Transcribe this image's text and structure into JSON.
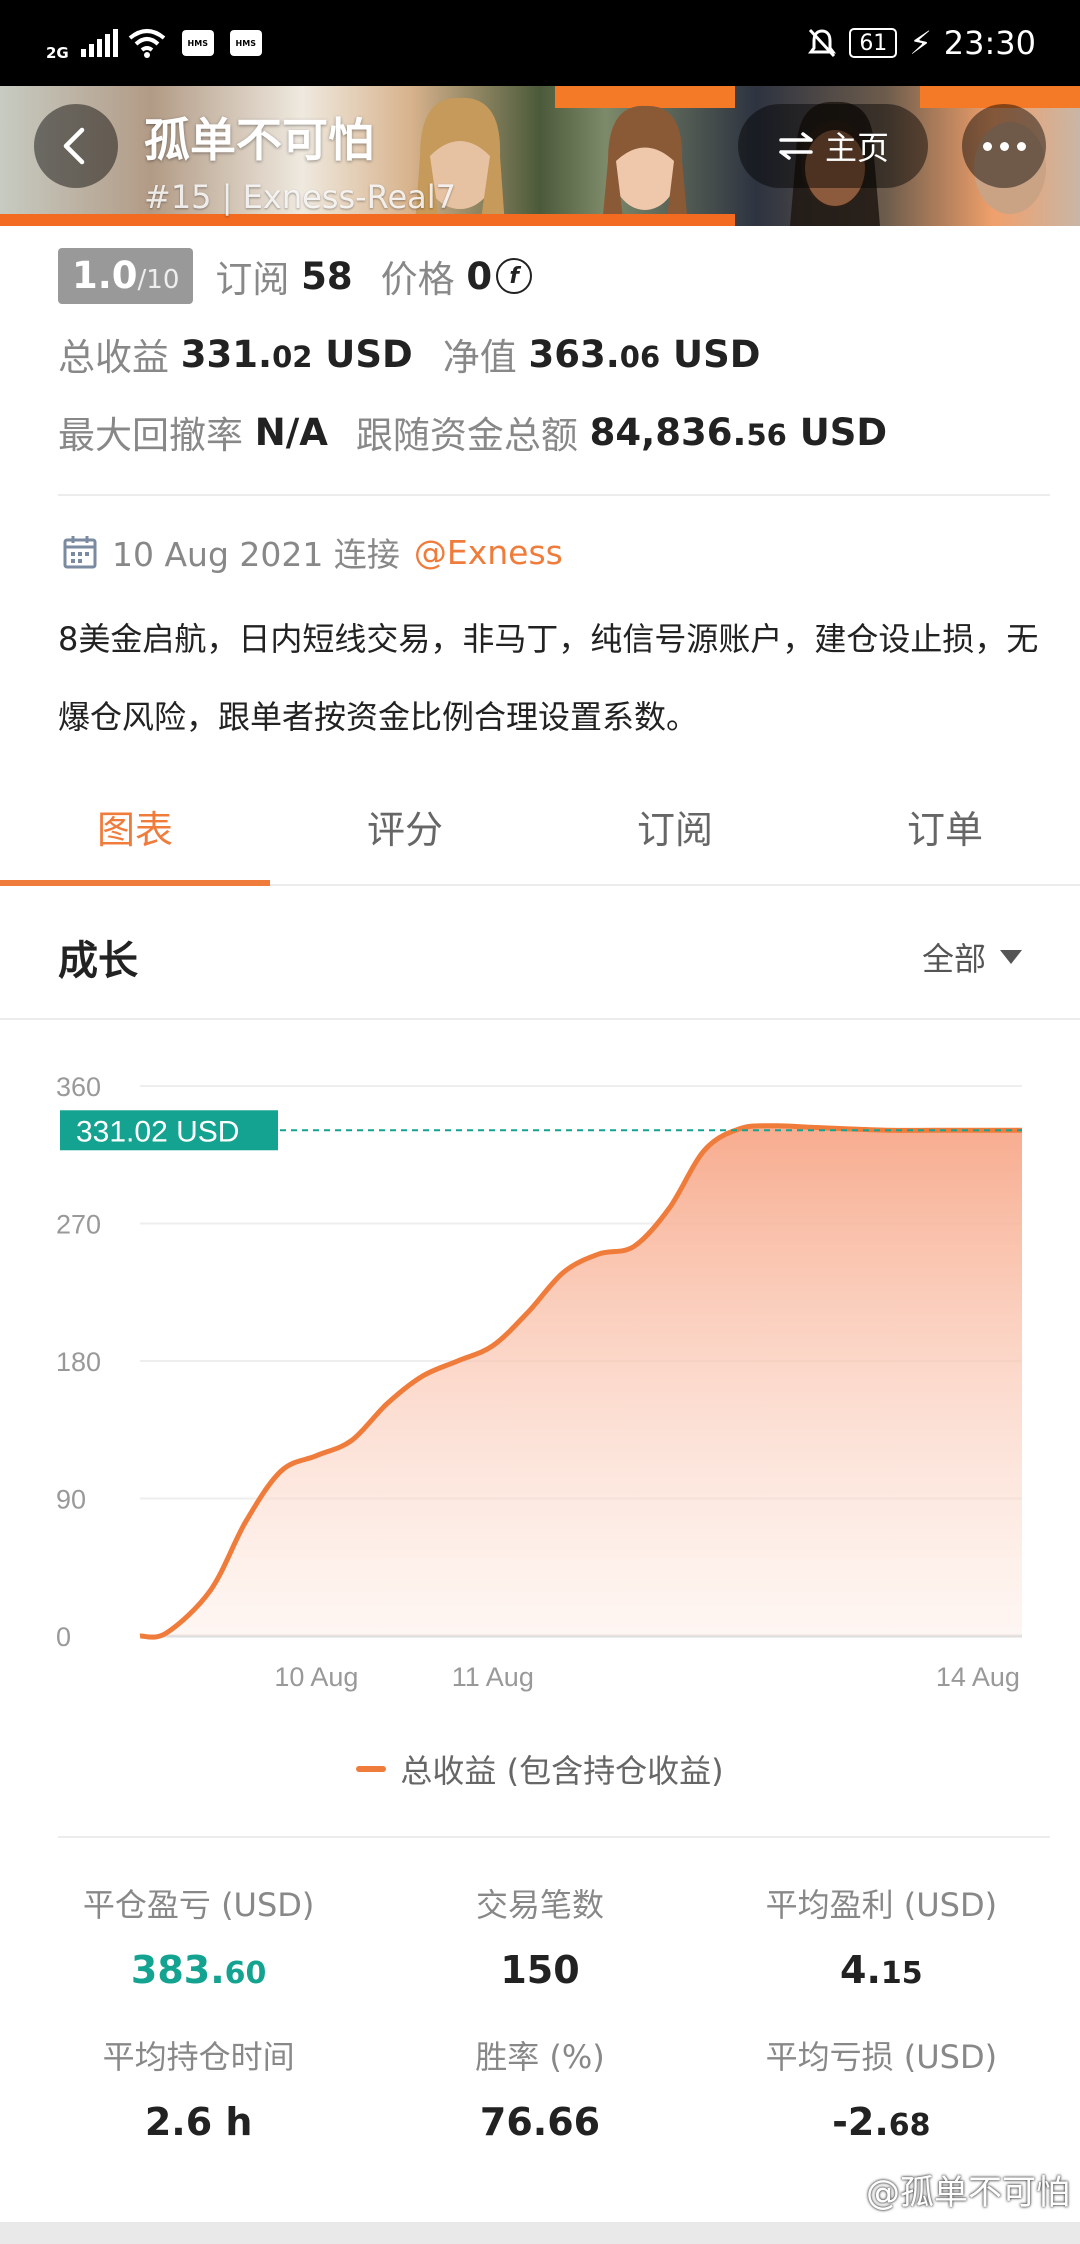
{
  "status_bar": {
    "network": "2G",
    "hms1": "HMS",
    "hms2": "HMS",
    "battery": "61",
    "time": "23:30"
  },
  "header": {
    "title": "孤单不可怕",
    "subtitle": "#15 | Exness-Real7",
    "home_label": "主页"
  },
  "info": {
    "rating": "1.0",
    "rating_max": "/10",
    "subscribe_label": "订阅",
    "subscribe_count": "58",
    "price_label": "价格",
    "price_value": "0",
    "total_profit_label": "总收益",
    "total_profit_int": "331.",
    "total_profit_dec": "02",
    "total_profit_unit": " USD",
    "equity_label": "净值",
    "equity_int": "363.",
    "equity_dec": "06",
    "equity_unit": " USD",
    "drawdown_label": "最大回撤率",
    "drawdown_value": "N/A",
    "follow_funds_label": "跟随资金总额",
    "follow_funds_int": "84,836.",
    "follow_funds_dec": "56",
    "follow_funds_unit": " USD"
  },
  "connect": {
    "date": "10 Aug 2021 连接",
    "broker": "@Exness"
  },
  "description": "8美金启航，日内短线交易，非马丁，纯信号源账户，建仓设止损，无爆仓风险，跟单者按资金比例合理设置系数。",
  "tabs": [
    {
      "label": "图表",
      "active": true
    },
    {
      "label": "评分",
      "active": false
    },
    {
      "label": "订阅",
      "active": false
    },
    {
      "label": "订单",
      "active": false
    }
  ],
  "section": {
    "title": "成长",
    "filter": "全部"
  },
  "chart_data": {
    "type": "area",
    "y_ticks": [
      "360",
      "270",
      "180",
      "90",
      "0"
    ],
    "ylim": [
      0,
      360
    ],
    "x_ticks": [
      {
        "label": "10 Aug",
        "x": 0.2
      },
      {
        "label": "11 Aug",
        "x": 0.4
      },
      {
        "label": "14 Aug",
        "x": 0.95
      }
    ],
    "series": [
      {
        "name": "总收益 (包含持仓收益)",
        "x": [
          0,
          0.03,
          0.08,
          0.12,
          0.16,
          0.2,
          0.24,
          0.28,
          0.32,
          0.36,
          0.4,
          0.44,
          0.48,
          0.52,
          0.56,
          0.6,
          0.64,
          0.68,
          0.72,
          0.76,
          0.8,
          0.85,
          0.9,
          0.95,
          1.0
        ],
        "values": [
          0,
          2,
          30,
          75,
          108,
          118,
          128,
          152,
          170,
          180,
          190,
          212,
          238,
          250,
          255,
          280,
          318,
          332,
          334,
          333,
          332,
          331,
          331,
          331,
          331
        ]
      }
    ],
    "current_label": "331.02 USD",
    "current_value": 331.02,
    "legend": "总收益 (包含持仓收益)",
    "grid": true
  },
  "stats": [
    {
      "label": "平仓盈亏 (USD)",
      "int": "383.",
      "dec": "60",
      "positive": true
    },
    {
      "label": "交易笔数",
      "int": "150",
      "dec": "",
      "positive": false
    },
    {
      "label": "平均盈利 (USD)",
      "int": "4.",
      "dec": "15",
      "positive": false
    },
    {
      "label": "平均持仓时间",
      "int": "2.6 h",
      "dec": "",
      "positive": false
    },
    {
      "label": "胜率 (%)",
      "int": "76.66",
      "dec": "",
      "positive": false
    },
    {
      "label": "平均亏损 (USD)",
      "int": "-2.",
      "dec": "68",
      "positive": false
    }
  ],
  "watermark": "@孤单不可怕",
  "colors": {
    "accent": "#f07c3c",
    "teal": "#14a391",
    "header_orange": "#f26b21"
  }
}
